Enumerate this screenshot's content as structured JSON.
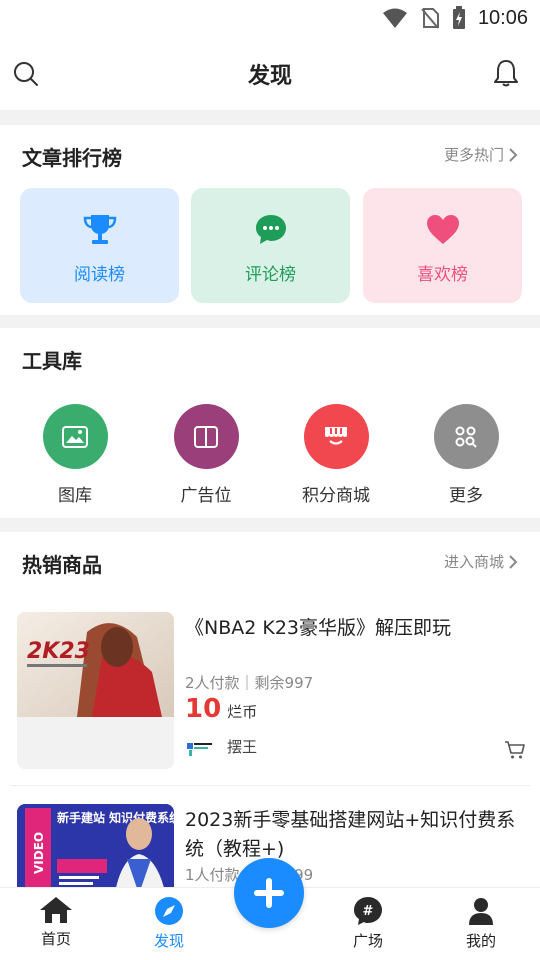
{
  "status_bar": {
    "time": "10:06"
  },
  "header": {
    "title": "发现"
  },
  "rankings": {
    "title": "文章排行榜",
    "more": "更多热门",
    "tiles": [
      {
        "label": "阅读榜",
        "icon": "trophy-icon",
        "color": "#1a8cff",
        "bg": "#dcebfd"
      },
      {
        "label": "评论榜",
        "icon": "comment-icon",
        "color": "#1e9d58",
        "bg": "#d9f1e6"
      },
      {
        "label": "喜欢榜",
        "icon": "heart-icon",
        "color": "#ef4f7c",
        "bg": "#fde4ea"
      }
    ]
  },
  "tools": {
    "title": "工具库",
    "items": [
      {
        "label": "图库",
        "icon": "image-icon",
        "color": "#3aad6e"
      },
      {
        "label": "广告位",
        "icon": "book-icon",
        "color": "#9b3f7a"
      },
      {
        "label": "积分商城",
        "icon": "shop-icon",
        "color": "#f0484e"
      },
      {
        "label": "更多",
        "icon": "grid-search-icon",
        "color": "#8e8e8e"
      }
    ]
  },
  "products": {
    "title": "热销商品",
    "more": "进入商城",
    "items": [
      {
        "title": "《NBA2 K23豪华版》解压即玩",
        "meta": "2人付款｜剩余997",
        "price": "10",
        "unit": "烂币",
        "seller": "摆王",
        "thumb_text": "2K23"
      },
      {
        "title": "2023新手零基础搭建网站+知识付费系统（教程+)",
        "meta": "1人付款｜剩余999",
        "thumb_text": "新手建站 知识付费系统"
      }
    ]
  },
  "tabbar": {
    "items": [
      {
        "label": "首页",
        "active": false
      },
      {
        "label": "发现",
        "active": true
      },
      {
        "label": "广场",
        "active": false
      },
      {
        "label": "我的",
        "active": false
      }
    ]
  },
  "colors": {
    "accent": "#1a8cff",
    "price": "#e53935"
  }
}
